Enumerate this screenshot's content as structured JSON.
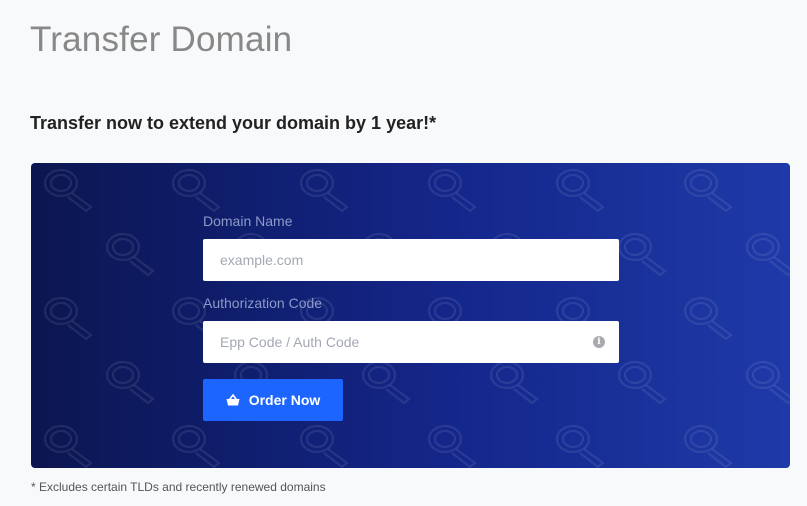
{
  "page": {
    "title": "Transfer Domain",
    "tagline": "Transfer now to extend your domain by 1 year!*",
    "footnote": "* Excludes certain TLDs and recently renewed domains"
  },
  "form": {
    "domain": {
      "label": "Domain Name",
      "placeholder": "example.com",
      "value": ""
    },
    "auth": {
      "label": "Authorization Code",
      "placeholder": "Epp Code / Auth Code",
      "value": "",
      "icon": "info-icon"
    },
    "order_button": {
      "label": "Order Now",
      "icon": "basket-icon"
    }
  },
  "banner": {
    "background_colors": [
      "#0b1650",
      "#1e3aa8"
    ],
    "pattern_icon": "magnifier-icon"
  },
  "colors": {
    "button": "#1c66ff",
    "title": "#888888"
  }
}
